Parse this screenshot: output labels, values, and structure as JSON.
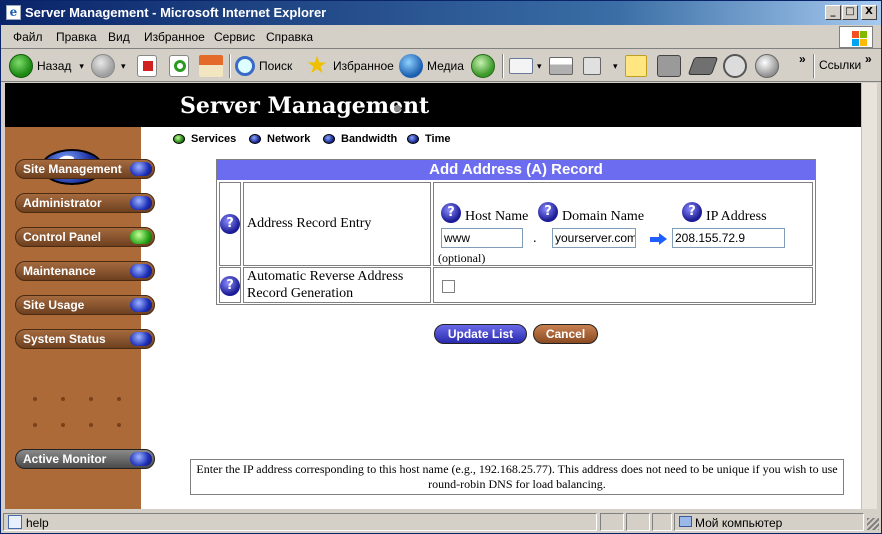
{
  "window": {
    "title": "Server Management - Microsoft Internet Explorer",
    "controls": {
      "minimize": "_",
      "maximize": "□",
      "close": "X"
    }
  },
  "menu": [
    "Файл",
    "Правка",
    "Вид",
    "Избранное",
    "Сервис",
    "Справка"
  ],
  "toolbar": {
    "back": "Назад",
    "search": "Поиск",
    "favorites": "Избранное",
    "media": "Медиа",
    "links": "Ссылки",
    "more": "»"
  },
  "page": {
    "banner_title": "Server Management",
    "tabs": [
      "Services",
      "Network",
      "Bandwidth",
      "Time"
    ],
    "sidebar": [
      "Site Management",
      "Administrator",
      "Control Panel",
      "Maintenance",
      "Site Usage",
      "System Status"
    ],
    "active_monitor": "Active Monitor",
    "form": {
      "heading": "Add Address (A) Record",
      "row1_label": "Address Record Entry",
      "host_name_label": "Host Name",
      "domain_name_label": "Domain Name",
      "ip_address_label": "IP Address",
      "host_value": "www",
      "dot": ".",
      "domain_value": "yourserver.com",
      "ip_value": "208.155.72.9",
      "optional": "(optional)",
      "row2_label": "Automatic Reverse Address Record Generation",
      "help_q": "?"
    },
    "buttons": {
      "update": "Update List",
      "cancel": "Cancel"
    },
    "help_text": "Enter the IP address corresponding to this host name (e.g., 192.168.25.77). This address does not need to be unique if you wish to use round-robin DNS for load balancing."
  },
  "status": {
    "left": "help",
    "zone": "Мой компьютер"
  },
  "colors": {
    "form_heading": "#6c6cf0",
    "sidebar": "#ab6a38",
    "banner": "#000000"
  }
}
